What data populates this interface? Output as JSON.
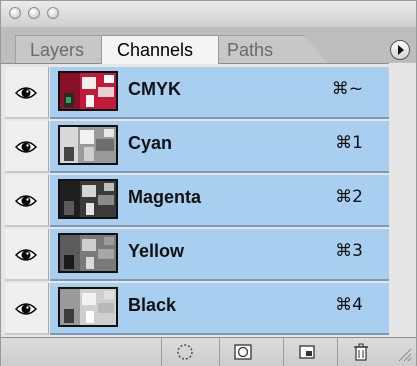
{
  "tabs": [
    {
      "label": "Layers"
    },
    {
      "label": "Channels"
    },
    {
      "label": "Paths"
    }
  ],
  "channels": [
    {
      "name": "CMYK",
      "shortcut": "⌘~"
    },
    {
      "name": "Cyan",
      "shortcut": "⌘1"
    },
    {
      "name": "Magenta",
      "shortcut": "⌘2"
    },
    {
      "name": "Yellow",
      "shortcut": "⌘3"
    },
    {
      "name": "Black",
      "shortcut": "⌘4"
    }
  ],
  "colors": {
    "selection": "#a9cff0",
    "selection_border": "#7c9ab7",
    "panel_bg": "#e6e6e6"
  },
  "footer_icons": [
    "load-selection-icon",
    "save-selection-icon",
    "new-channel-icon",
    "trash-icon"
  ]
}
